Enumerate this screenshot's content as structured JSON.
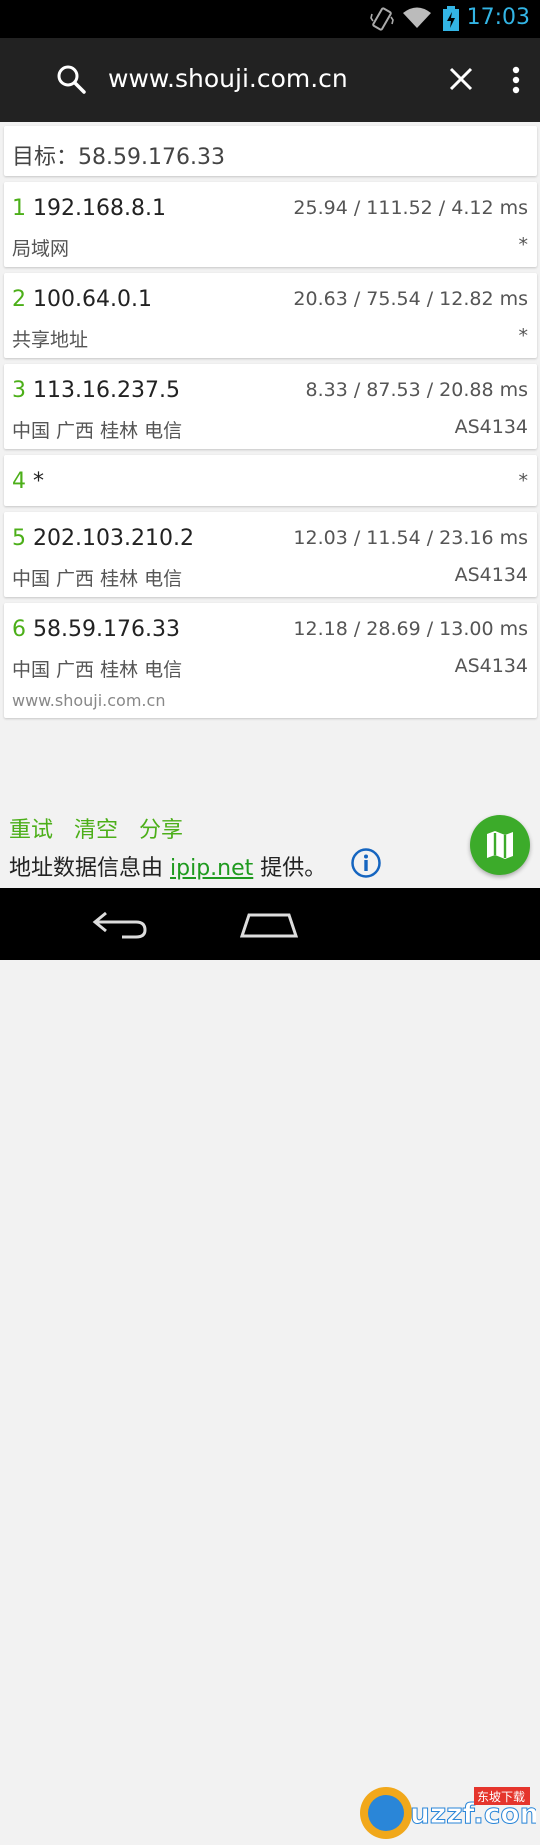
{
  "status_bar": {
    "time": "17:03"
  },
  "toolbar": {
    "url": "www.shouji.com.cn"
  },
  "target": {
    "label": "目标：58.59.176.33"
  },
  "hops": [
    {
      "num": "1",
      "ip": "192.168.8.1",
      "rtt": "25.94 / 111.52 / 4.12 ms",
      "location": "局域网",
      "asn": "*"
    },
    {
      "num": "2",
      "ip": "100.64.0.1",
      "rtt": "20.63 / 75.54 / 12.82 ms",
      "location": "共享地址",
      "asn": "*"
    },
    {
      "num": "3",
      "ip": "113.16.237.5",
      "rtt": "8.33 / 87.53 / 20.88 ms",
      "location": "中国 广西 桂林 电信",
      "asn": "AS4134"
    },
    {
      "num": "4",
      "ip": "*",
      "rtt": "*"
    },
    {
      "num": "5",
      "ip": "202.103.210.2",
      "rtt": "12.03 / 11.54 / 23.16 ms",
      "location": "中国 广西 桂林 电信",
      "asn": "AS4134"
    },
    {
      "num": "6",
      "ip": "58.59.176.33",
      "rtt": "12.18 / 28.69 / 13.00 ms",
      "location": "中国 广西 桂林 电信",
      "asn": "AS4134",
      "site": "www.shouji.com.cn"
    }
  ],
  "actions": {
    "retry": "重试",
    "clear": "清空",
    "share": "分享"
  },
  "info": {
    "prefix": "地址数据信息由",
    "link": "ipip.net",
    "suffix": "提供。"
  },
  "watermark": {
    "text": "uzzf.com",
    "tag": "东坡下载"
  },
  "colors": {
    "accent_green": "#4caf19",
    "status_blue": "#33b5e5",
    "toolbar": "#222222"
  }
}
